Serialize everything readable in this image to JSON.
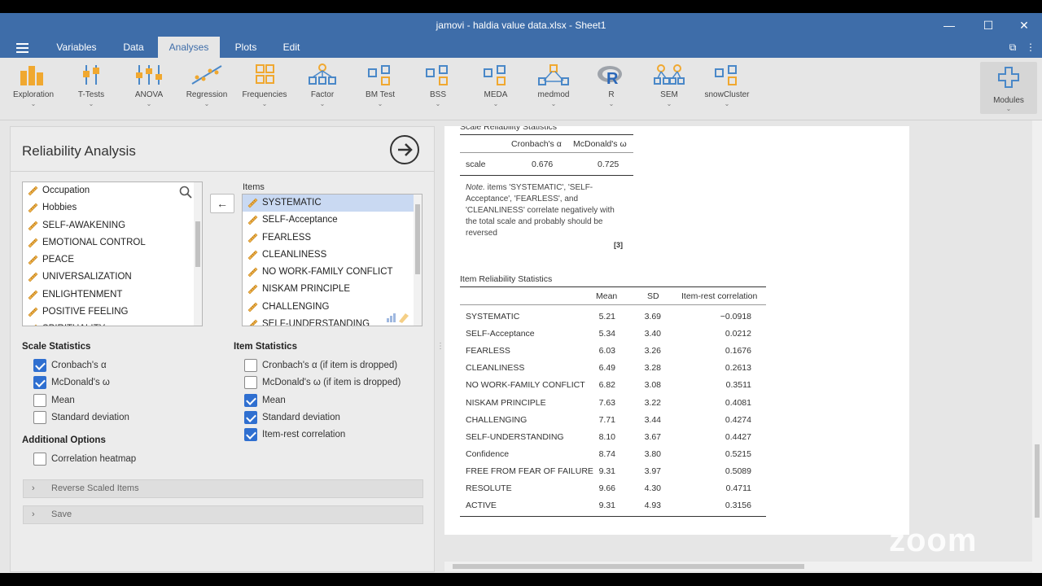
{
  "window": {
    "title": "jamovi - haldia value data.xlsx - Sheet1"
  },
  "menu": {
    "tabs": [
      "Variables",
      "Data",
      "Analyses",
      "Plots",
      "Edit"
    ],
    "active": "Analyses"
  },
  "toolbar": {
    "tools": [
      {
        "label": "Exploration",
        "icon": "exploration-icon"
      },
      {
        "label": "T-Tests",
        "icon": "ttests-icon"
      },
      {
        "label": "ANOVA",
        "icon": "anova-icon"
      },
      {
        "label": "Regression",
        "icon": "regression-icon"
      },
      {
        "label": "Frequencies",
        "icon": "frequencies-icon"
      },
      {
        "label": "Factor",
        "icon": "factor-icon"
      },
      {
        "label": "BM Test",
        "icon": "module-icon"
      },
      {
        "label": "BSS",
        "icon": "module-icon"
      },
      {
        "label": "MEDA",
        "icon": "module-icon"
      },
      {
        "label": "medmod",
        "icon": "medmod-icon"
      },
      {
        "label": "R",
        "icon": "r-icon"
      },
      {
        "label": "SEM",
        "icon": "sem-icon"
      },
      {
        "label": "snowCluster",
        "icon": "module-icon"
      }
    ],
    "modules_label": "Modules"
  },
  "analysis": {
    "title": "Reliability Analysis",
    "variables": [
      "Occupation",
      "Hobbies",
      "SELF-AWAKENING",
      "EMOTIONAL CONTROL",
      "PEACE",
      "UNIVERSALIZATION",
      "ENLIGHTENMENT",
      "POSITIVE FEELING",
      "SPIRITUALITY"
    ],
    "items_label": "Items",
    "items": [
      "SYSTEMATIC",
      "SELF-Acceptance",
      "FEARLESS",
      "CLEANLINESS",
      "NO WORK-FAMILY CONFLICT",
      "NISKAM PRINCIPLE",
      "CHALLENGING",
      "SELF-UNDERSTANDING"
    ],
    "scale_statistics": {
      "title": "Scale Statistics",
      "options": [
        {
          "label": "Cronbach's α",
          "checked": true
        },
        {
          "label": "McDonald's ω",
          "checked": true
        },
        {
          "label": "Mean",
          "checked": false
        },
        {
          "label": "Standard deviation",
          "checked": false
        }
      ]
    },
    "item_statistics": {
      "title": "Item Statistics",
      "options": [
        {
          "label": "Cronbach's α (if item is dropped)",
          "checked": false
        },
        {
          "label": "McDonald's ω (if item is dropped)",
          "checked": false
        },
        {
          "label": "Mean",
          "checked": true
        },
        {
          "label": "Standard deviation",
          "checked": true
        },
        {
          "label": "Item-rest correlation",
          "checked": true
        }
      ]
    },
    "additional_options": {
      "title": "Additional Options",
      "options": [
        {
          "label": "Correlation heatmap",
          "checked": false
        }
      ]
    },
    "sections": [
      "Reverse Scaled Items",
      "Save"
    ]
  },
  "results": {
    "scale_table": {
      "title": "Scale Reliability Statistics",
      "headers": [
        "",
        "Cronbach's α",
        "McDonald's ω"
      ],
      "row": {
        "label": "scale",
        "alpha": "0.676",
        "omega": "0.725"
      },
      "note_label": "Note.",
      "note_text": " items 'SYSTEMATIC', 'SELF-Acceptance', 'FEARLESS', and 'CLEANLINESS' correlate negatively with the total scale and probably should be reversed",
      "ref": "[3]"
    },
    "item_table": {
      "title": "Item Reliability Statistics",
      "headers": [
        "",
        "Mean",
        "SD",
        "Item-rest correlation"
      ],
      "rows": [
        {
          "item": "SYSTEMATIC",
          "mean": "5.21",
          "sd": "3.69",
          "irc": "−0.0918"
        },
        {
          "item": "SELF-Acceptance",
          "mean": "5.34",
          "sd": "3.40",
          "irc": "0.0212"
        },
        {
          "item": "FEARLESS",
          "mean": "6.03",
          "sd": "3.26",
          "irc": "0.1676"
        },
        {
          "item": "CLEANLINESS",
          "mean": "6.49",
          "sd": "3.28",
          "irc": "0.2613"
        },
        {
          "item": "NO WORK-FAMILY CONFLICT",
          "mean": "6.82",
          "sd": "3.08",
          "irc": "0.3511"
        },
        {
          "item": "NISKAM PRINCIPLE",
          "mean": "7.63",
          "sd": "3.22",
          "irc": "0.4081"
        },
        {
          "item": "CHALLENGING",
          "mean": "7.71",
          "sd": "3.44",
          "irc": "0.4274"
        },
        {
          "item": "SELF-UNDERSTANDING",
          "mean": "8.10",
          "sd": "3.67",
          "irc": "0.4427"
        },
        {
          "item": "Confidence",
          "mean": "8.74",
          "sd": "3.80",
          "irc": "0.5215"
        },
        {
          "item": "FREE FROM FEAR OF FAILURE",
          "mean": "9.31",
          "sd": "3.97",
          "irc": "0.5089"
        },
        {
          "item": "RESOLUTE",
          "mean": "9.66",
          "sd": "4.30",
          "irc": "0.4711"
        },
        {
          "item": "ACTIVE",
          "mean": "9.31",
          "sd": "4.93",
          "irc": "0.3156"
        }
      ]
    }
  },
  "watermark": "zoom",
  "colors": {
    "accent": "#3e6da9",
    "checkbox": "#2f6fd0",
    "icon_orange": "#f0a830",
    "icon_blue": "#4a88c8"
  }
}
